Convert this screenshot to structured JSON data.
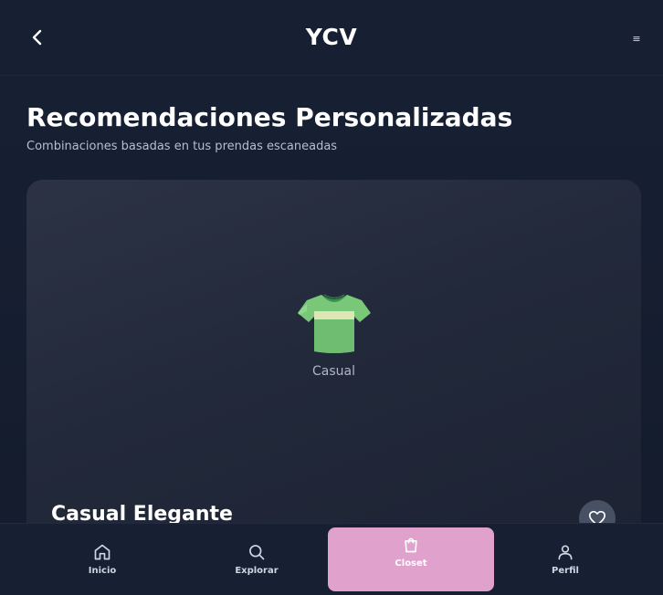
{
  "header": {
    "title": "YCV",
    "back_icon": "chevron-left-icon",
    "menu_glyph": "≡"
  },
  "main": {
    "title": "Recomendaciones Personalizadas",
    "subtitle": "Combinaciones basadas en tus prendas escaneadas",
    "card": {
      "icon": "t-shirt-icon",
      "category": "Casual",
      "title": "Casual Elegante",
      "favorite_icon": "heart-icon"
    }
  },
  "bottom_nav": {
    "items": [
      {
        "label": "Inicio",
        "icon": "home-icon"
      },
      {
        "label": "Explorar",
        "icon": "search-icon"
      },
      {
        "label": "Closet",
        "icon": "shopping-bag-icon",
        "active": true
      },
      {
        "label": "Perfil",
        "icon": "user-icon"
      }
    ]
  },
  "colors": {
    "background": "#141c2d",
    "header_bg": "#172033",
    "card_bg": "#2a3142",
    "active_nav": "#e0a2cc",
    "shirt_green": "#79c879"
  }
}
